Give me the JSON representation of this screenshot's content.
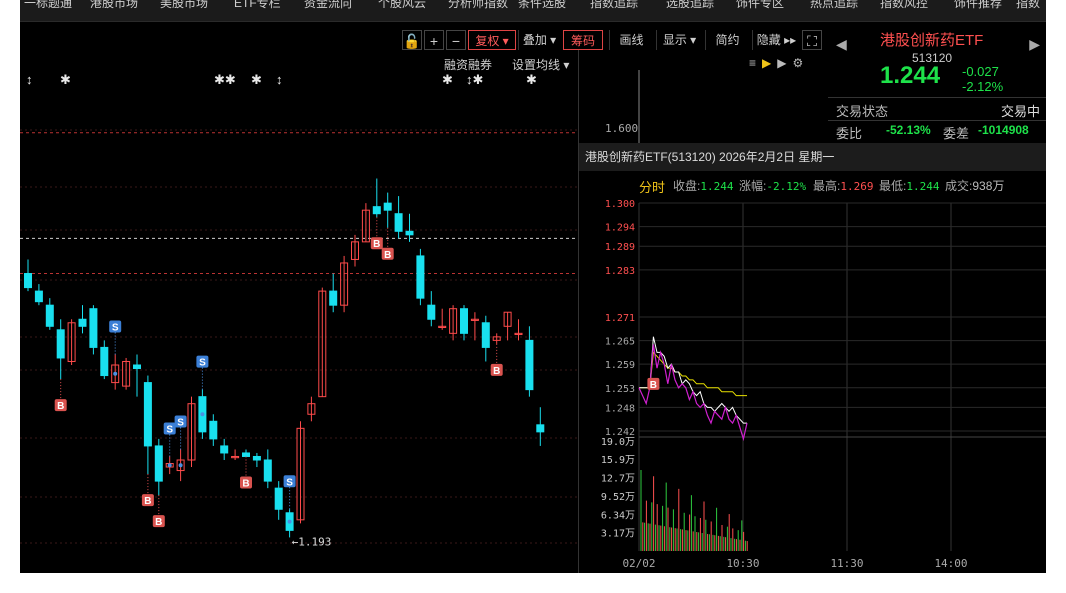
{
  "topnav": [
    "一标题通",
    "港股市场",
    "美股市场",
    "ETF专栏",
    "资金流向",
    "个股风云",
    "分析师指数",
    "条件选股",
    "指数追踪",
    "选股追踪",
    "饰件专区",
    "热点追踪",
    "指数风控",
    "饰件推荐",
    "指数"
  ],
  "toolbar": {
    "lock_icon": "lock-icon",
    "plus": "+",
    "minus": "−",
    "fuquan": "复权",
    "diejia": "叠加",
    "chouma": "筹码",
    "huaxian": "画线",
    "xianshi": "显示",
    "jianyue": "简约",
    "yincang": "隐藏"
  },
  "kline": {
    "rongzi": "融资融券",
    "ma_setting": "设置均线",
    "low_label": "←1.193",
    "colors": {
      "up": "#ff4b4b",
      "down": "#19e0ef",
      "bg": "#000000"
    }
  },
  "quote": {
    "name": "港股创新药ETF",
    "code": "513120",
    "price": "1.244",
    "change": "-0.027",
    "change_pct": "-2.12%",
    "status_label": "交易状态",
    "status_value": "交易中",
    "weibi_label": "委比",
    "weibi_value": "-52.13%",
    "weicha_label": "委差",
    "weicha_value": "-1014908"
  },
  "mini": {
    "price_label": "1.600"
  },
  "fenshi": {
    "title": "港股创新药ETF(513120) 2026年2月2日 星期一",
    "tab": "分时",
    "close_label": "收盘:",
    "close_value": "1.244",
    "chg_label": "涨幅:",
    "chg_value": "-2.12%",
    "high_label": "最高:",
    "high_value": "1.269",
    "low_label": "最低:",
    "low_value": "1.244",
    "vol_label": "成交:",
    "vol_value": "938万",
    "price_ticks": [
      "1.300",
      "1.294",
      "1.289",
      "1.283",
      "1.271",
      "1.265",
      "1.259",
      "1.253",
      "1.248",
      "1.242"
    ],
    "vol_ticks": [
      "19.0万",
      "15.9万",
      "12.7万",
      "9.52万",
      "6.34万",
      "3.17万"
    ],
    "time_ticks": [
      "02/02",
      "10:30",
      "11:30",
      "14:00"
    ],
    "marker_b": "B"
  },
  "chart_data": {
    "type": "candlestick",
    "candles": [
      {
        "o": 1.245,
        "h": 1.249,
        "l": 1.24,
        "c": 1.241
      },
      {
        "o": 1.24,
        "h": 1.242,
        "l": 1.236,
        "c": 1.237
      },
      {
        "o": 1.236,
        "h": 1.238,
        "l": 1.229,
        "c": 1.23
      },
      {
        "o": 1.229,
        "h": 1.232,
        "l": 1.215,
        "c": 1.221
      },
      {
        "o": 1.22,
        "h": 1.232,
        "l": 1.219,
        "c": 1.231
      },
      {
        "o": 1.232,
        "h": 1.236,
        "l": 1.228,
        "c": 1.23
      },
      {
        "o": 1.235,
        "h": 1.236,
        "l": 1.222,
        "c": 1.224
      },
      {
        "o": 1.224,
        "h": 1.226,
        "l": 1.215,
        "c": 1.216
      },
      {
        "o": 1.214,
        "h": 1.222,
        "l": 1.212,
        "c": 1.219
      },
      {
        "o": 1.213,
        "h": 1.221,
        "l": 1.212,
        "c": 1.22
      },
      {
        "o": 1.219,
        "h": 1.222,
        "l": 1.21,
        "c": 1.218
      },
      {
        "o": 1.214,
        "h": 1.216,
        "l": 1.188,
        "c": 1.196
      },
      {
        "o": 1.196,
        "h": 1.198,
        "l": 1.182,
        "c": 1.186
      },
      {
        "o": 1.19,
        "h": 1.193,
        "l": 1.188,
        "c": 1.191
      },
      {
        "o": 1.189,
        "h": 1.195,
        "l": 1.186,
        "c": 1.192
      },
      {
        "o": 1.192,
        "h": 1.21,
        "l": 1.19,
        "c": 1.208
      },
      {
        "o": 1.21,
        "h": 1.212,
        "l": 1.198,
        "c": 1.2
      },
      {
        "o": 1.203,
        "h": 1.205,
        "l": 1.196,
        "c": 1.198
      },
      {
        "o": 1.196,
        "h": 1.198,
        "l": 1.192,
        "c": 1.194
      },
      {
        "o": 1.193,
        "h": 1.195,
        "l": 1.192,
        "c": 1.193
      },
      {
        "o": 1.194,
        "h": 1.195,
        "l": 1.193,
        "c": 1.193
      },
      {
        "o": 1.193,
        "h": 1.194,
        "l": 1.19,
        "c": 1.192
      },
      {
        "o": 1.192,
        "h": 1.195,
        "l": 1.184,
        "c": 1.186
      },
      {
        "o": 1.184,
        "h": 1.186,
        "l": 1.175,
        "c": 1.178
      },
      {
        "o": 1.177,
        "h": 1.178,
        "l": 1.17,
        "c": 1.172
      },
      {
        "o": 1.175,
        "h": 1.203,
        "l": 1.174,
        "c": 1.201
      },
      {
        "o": 1.205,
        "h": 1.21,
        "l": 1.203,
        "c": 1.208
      },
      {
        "o": 1.21,
        "h": 1.241,
        "l": 1.21,
        "c": 1.24
      },
      {
        "o": 1.24,
        "h": 1.245,
        "l": 1.234,
        "c": 1.236
      },
      {
        "o": 1.236,
        "h": 1.25,
        "l": 1.234,
        "c": 1.248
      },
      {
        "o": 1.249,
        "h": 1.256,
        "l": 1.247,
        "c": 1.254
      },
      {
        "o": 1.254,
        "h": 1.265,
        "l": 1.254,
        "c": 1.263
      },
      {
        "o": 1.264,
        "h": 1.272,
        "l": 1.261,
        "c": 1.262
      },
      {
        "o": 1.265,
        "h": 1.268,
        "l": 1.258,
        "c": 1.263
      },
      {
        "o": 1.262,
        "h": 1.267,
        "l": 1.255,
        "c": 1.257
      },
      {
        "o": 1.257,
        "h": 1.262,
        "l": 1.254,
        "c": 1.256
      },
      {
        "o": 1.25,
        "h": 1.252,
        "l": 1.236,
        "c": 1.238
      },
      {
        "o": 1.236,
        "h": 1.24,
        "l": 1.23,
        "c": 1.232
      },
      {
        "o": 1.23,
        "h": 1.235,
        "l": 1.229,
        "c": 1.23
      },
      {
        "o": 1.228,
        "h": 1.236,
        "l": 1.226,
        "c": 1.235
      },
      {
        "o": 1.235,
        "h": 1.236,
        "l": 1.226,
        "c": 1.228
      },
      {
        "o": 1.232,
        "h": 1.234,
        "l": 1.226,
        "c": 1.232
      },
      {
        "o": 1.231,
        "h": 1.233,
        "l": 1.22,
        "c": 1.224
      },
      {
        "o": 1.226,
        "h": 1.228,
        "l": 1.225,
        "c": 1.227
      },
      {
        "o": 1.23,
        "h": 1.234,
        "l": 1.226,
        "c": 1.234
      },
      {
        "o": 1.228,
        "h": 1.232,
        "l": 1.226,
        "c": 1.228
      },
      {
        "o": 1.226,
        "h": 1.23,
        "l": 1.21,
        "c": 1.212
      },
      {
        "o": 1.202,
        "h": 1.207,
        "l": 1.196,
        "c": 1.2
      }
    ],
    "sell_markers": [
      8,
      13,
      14,
      16,
      24
    ],
    "buy_markers": [
      3,
      11,
      12,
      20,
      32,
      33,
      43
    ],
    "y_range": [
      1.165,
      1.3
    ],
    "hlines": [
      1.285,
      1.255,
      1.245
    ],
    "intraday_price": [
      1.253,
      1.253,
      1.253,
      1.253,
      1.266,
      1.262,
      1.262,
      1.261,
      1.258,
      1.259,
      1.257,
      1.257,
      1.254,
      1.255,
      1.254,
      1.252,
      1.251,
      1.252,
      1.249,
      1.248,
      1.248,
      1.247,
      1.248,
      1.249,
      1.248,
      1.247,
      1.248,
      1.246,
      1.245,
      1.244,
      1.244
    ],
    "intraday_avg": [
      1.253,
      1.253,
      1.253,
      1.253,
      1.262,
      1.261,
      1.26,
      1.259,
      1.258,
      1.258,
      1.257,
      1.257,
      1.256,
      1.256,
      1.255,
      1.255,
      1.254,
      1.254,
      1.254,
      1.253,
      1.253,
      1.253,
      1.253,
      1.252,
      1.252,
      1.252,
      1.252,
      1.251,
      1.251,
      1.251,
      1.251
    ],
    "intraday_ylim": [
      1.242,
      1.3
    ],
    "volume_ylim": [
      0,
      19.0
    ]
  }
}
